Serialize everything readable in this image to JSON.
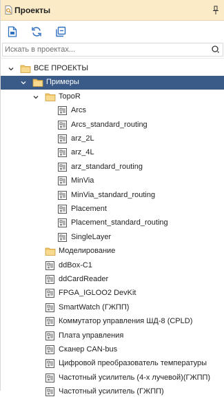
{
  "panel": {
    "title": "Проекты",
    "pin_glyph": "ꟷ"
  },
  "toolbar": {
    "buttons": [
      {
        "name": "new-project-button",
        "icon": "new-doc-icon"
      },
      {
        "name": "refresh-button",
        "icon": "refresh-icon"
      },
      {
        "name": "collapse-all-button",
        "icon": "collapse-icon"
      }
    ]
  },
  "search": {
    "placeholder": "Искать в проектах...",
    "value": ""
  },
  "tree": [
    {
      "label": "ВСЕ ПРОЕКТЫ",
      "type": "folder",
      "level": 0,
      "expanded": true
    },
    {
      "label": "Примеры",
      "type": "folder",
      "level": 1,
      "expanded": true,
      "selected": true
    },
    {
      "label": "TopoR",
      "type": "folder",
      "level": 2,
      "expanded": true
    },
    {
      "label": "Arcs",
      "type": "project",
      "level": 3
    },
    {
      "label": "Arcs_standard_routing",
      "type": "project",
      "level": 3
    },
    {
      "label": "arz_2L",
      "type": "project",
      "level": 3
    },
    {
      "label": "arz_4L",
      "type": "project",
      "level": 3
    },
    {
      "label": "arz_standard_routing",
      "type": "project",
      "level": 3
    },
    {
      "label": "MinVia",
      "type": "project",
      "level": 3
    },
    {
      "label": "MinVia_standard_routing",
      "type": "project",
      "level": 3
    },
    {
      "label": "Placement",
      "type": "project",
      "level": 3
    },
    {
      "label": "Placement_standard_routing",
      "type": "project",
      "level": 3
    },
    {
      "label": "SingleLayer",
      "type": "project",
      "level": 3
    },
    {
      "label": "Моделирование",
      "type": "folder",
      "level": 2,
      "expanded": false
    },
    {
      "label": "ddBox-C1",
      "type": "project",
      "level": 2
    },
    {
      "label": "ddCardReader",
      "type": "project",
      "level": 2
    },
    {
      "label": "FPGA_IGLOO2 DevKit",
      "type": "project",
      "level": 2
    },
    {
      "label": "SmartWatch (ГЖПП)",
      "type": "project",
      "level": 2
    },
    {
      "label": "Коммутатор управления ШД-8 (CPLD)",
      "type": "project",
      "level": 2
    },
    {
      "label": "Плата управления",
      "type": "project",
      "level": 2
    },
    {
      "label": "Сканер CAN-bus",
      "type": "project",
      "level": 2
    },
    {
      "label": "Цифровой преобразователь температуры",
      "type": "project",
      "level": 2
    },
    {
      "label": "Частотный усилитель (4-х лучевой)(ГЖПП)",
      "type": "project",
      "level": 2
    },
    {
      "label": "Частотный усилитель (ГЖПП)",
      "type": "project",
      "level": 2
    }
  ],
  "colors": {
    "title_bg": "#fcebc7",
    "selection_bg": "#3a5a87",
    "folder": "#f2c76b",
    "toolbar_icon": "#2f6fbf"
  }
}
